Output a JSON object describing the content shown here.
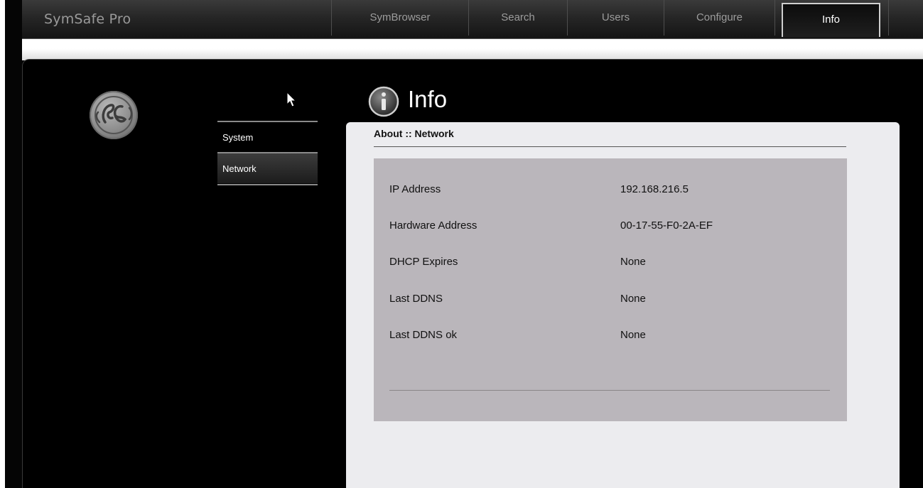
{
  "app": {
    "title": "SymSafe Pro"
  },
  "nav": {
    "tabs": [
      {
        "label": "SymBrowser",
        "active": false
      },
      {
        "label": "Search",
        "active": false
      },
      {
        "label": "Users",
        "active": false
      },
      {
        "label": "Configure",
        "active": false
      },
      {
        "label": "Info",
        "active": true
      }
    ]
  },
  "sidebar": {
    "logo_icon": "ge-logo-icon",
    "items": [
      {
        "label": "System",
        "active": false
      },
      {
        "label": "Network",
        "active": true
      }
    ]
  },
  "page": {
    "title": "Info",
    "title_icon": "info-circle-icon"
  },
  "about": {
    "heading": "About :: Network",
    "rows": [
      {
        "label": "IP Address",
        "value": "192.168.216.5"
      },
      {
        "label": "Hardware Address",
        "value": "00-17-55-F0-2A-EF"
      },
      {
        "label": "DHCP Expires",
        "value": "None"
      },
      {
        "label": "Last DDNS",
        "value": "None"
      },
      {
        "label": "Last DDNS ok",
        "value": "None"
      }
    ]
  },
  "colors": {
    "background": "#000000",
    "card": "#ececef",
    "info_box": "#bab6bb",
    "nav_text": "#9c9c9c",
    "active_text": "#ffffff"
  }
}
